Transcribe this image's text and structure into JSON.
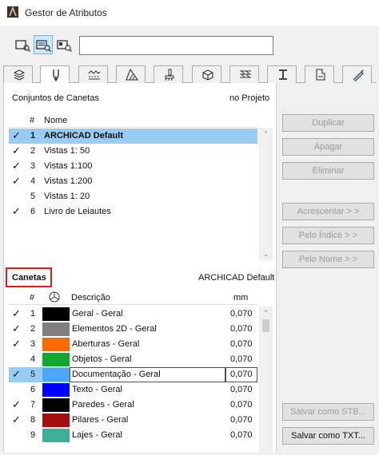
{
  "window": {
    "title": "Gestor de Atributos"
  },
  "view_buttons": [
    {
      "name": "list-view-button",
      "icon": "list-view-icon",
      "active": false
    },
    {
      "name": "grid-view-button",
      "icon": "grid-view-icon",
      "active": true
    },
    {
      "name": "detail-view-button",
      "icon": "detail-view-icon",
      "active": false
    }
  ],
  "search": {
    "value": "",
    "placeholder": ""
  },
  "tabs": [
    {
      "icon": "layers-icon",
      "active": false
    },
    {
      "icon": "pen-icon",
      "active": true
    },
    {
      "icon": "line-types-icon",
      "active": false
    },
    {
      "icon": "fill-types-icon",
      "active": false
    },
    {
      "icon": "surfaces-icon",
      "active": false
    },
    {
      "icon": "building-materials-icon",
      "active": false
    },
    {
      "icon": "composites-icon",
      "active": false
    },
    {
      "icon": "profiles-icon",
      "active": false
    },
    {
      "icon": "zone-categories-icon",
      "active": false
    },
    {
      "icon": "mep-systems-icon",
      "active": false
    }
  ],
  "pen_sets": {
    "title": "Conjuntos de Canetas",
    "location": "no Projeto",
    "headers": {
      "num": "#",
      "name": "Nome"
    },
    "rows": [
      {
        "check": "✓",
        "num": "1",
        "name": "ARCHICAD Default",
        "selected": true
      },
      {
        "check": "✓",
        "num": "2",
        "name": "Vistas 1: 50",
        "selected": false
      },
      {
        "check": "✓",
        "num": "3",
        "name": "Vistas 1:100",
        "selected": false
      },
      {
        "check": "✓",
        "num": "4",
        "name": "Vistas 1:200",
        "selected": false
      },
      {
        "check": "",
        "num": "5",
        "name": "Vistas 1: 20",
        "selected": false
      },
      {
        "check": "✓",
        "num": "6",
        "name": "Livro de Leiautes",
        "selected": false
      }
    ]
  },
  "buttons": {
    "duplicar": "Duplicar",
    "apagar": "Apagar",
    "eliminar": "Eliminar",
    "acrescentar": "Acrescentar > >",
    "pelo_indice": "Pelo Índice > >",
    "pelo_nome": "Pelo Nome > >",
    "salvar_stb": "Salvar como STB...",
    "salvar_txt": "Salvar como TXT..."
  },
  "pens": {
    "title": "Canetas",
    "set_name": "ARCHICAD Default",
    "headers": {
      "num": "#",
      "desc": "Descrição",
      "unit": "mm"
    },
    "rows": [
      {
        "check": "✓",
        "num": "1",
        "color": "#000000",
        "desc": "Geral - Geral",
        "mm": "0,070",
        "selected": false
      },
      {
        "check": "✓",
        "num": "2",
        "color": "#7f7f7f",
        "desc": "Elementos 2D - Geral",
        "mm": "0,070",
        "selected": false
      },
      {
        "check": "✓",
        "num": "3",
        "color": "#ff6a00",
        "desc": "Aberturas - Geral",
        "mm": "0,070",
        "selected": false
      },
      {
        "check": "",
        "num": "4",
        "color": "#11a832",
        "desc": "Objetos - Geral",
        "mm": "0,070",
        "selected": false
      },
      {
        "check": "✓",
        "num": "5",
        "color": "#4da6ff",
        "desc": "Documentação - Geral",
        "mm": "0,070",
        "selected": true
      },
      {
        "check": "",
        "num": "6",
        "color": "#0000ff",
        "desc": "Texto - Geral",
        "mm": "0,070",
        "selected": false
      },
      {
        "check": "✓",
        "num": "7",
        "color": "#000000",
        "desc": "Paredes - Geral",
        "mm": "0,070",
        "selected": false
      },
      {
        "check": "✓",
        "num": "8",
        "color": "#a30f0f",
        "desc": "Pilares - Geral",
        "mm": "0,070",
        "selected": false
      },
      {
        "check": "",
        "num": "9",
        "color": "#3fae97",
        "desc": "Lajes - Geral",
        "mm": "0,070",
        "selected": false
      }
    ]
  }
}
